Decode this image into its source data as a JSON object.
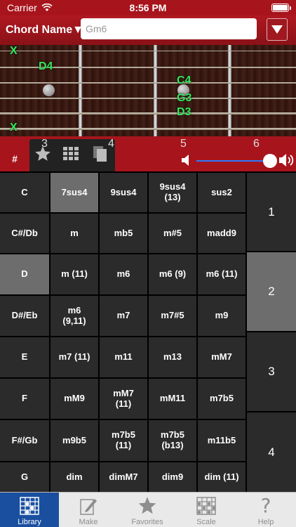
{
  "status": {
    "carrier": "Carrier",
    "time": "8:56 PM"
  },
  "header": {
    "chord_name_label": "Chord Name▼",
    "chord_input_placeholder": "Gm6"
  },
  "fretboard": {
    "markers": [
      {
        "text": "X"
      },
      {
        "text": "D4"
      },
      {
        "text": "C4"
      },
      {
        "text": "G3"
      },
      {
        "text": "D3"
      },
      {
        "text": "X"
      }
    ],
    "fret_numbers": [
      "3",
      "4",
      "5",
      "6"
    ]
  },
  "toolbar": {
    "sharp_label": "#",
    "icons": [
      "star-icon",
      "grid-icon",
      "copy-icon",
      "speaker-icon",
      "volume-icon"
    ],
    "volume_level": 0.95,
    "accent": "#2d7bff"
  },
  "roots": [
    "C",
    "C#/Db",
    "D",
    "D#/Eb",
    "E",
    "F",
    "F#/Gb",
    "G"
  ],
  "selected_root": "D",
  "chord_types": [
    [
      "7sus4",
      "9sus4",
      "9sus4\n(13)",
      "sus2"
    ],
    [
      "m",
      "mb5",
      "m#5",
      "madd9"
    ],
    [
      "m (11)",
      "m6",
      "m6 (9)",
      "m6 (11)"
    ],
    [
      "m6\n(9,11)",
      "m7",
      "m7#5",
      "m9"
    ],
    [
      "m7 (11)",
      "m11",
      "m13",
      "mM7"
    ],
    [
      "mM9",
      "mM7\n(11)",
      "mM11",
      "m7b5"
    ],
    [
      "m9b5",
      "m7b5\n(11)",
      "m7b5\n(b13)",
      "m11b5"
    ],
    [
      "dim",
      "dimM7",
      "dim9",
      "dim (11)"
    ]
  ],
  "selected_chord_type": "7sus4",
  "fingerings": [
    "1",
    "2",
    "3",
    "4"
  ],
  "selected_fingering": "2",
  "tabs": [
    {
      "label": "Library",
      "icon": "library-icon",
      "active": true
    },
    {
      "label": "Make",
      "icon": "pencil-icon"
    },
    {
      "label": "Favorites",
      "icon": "star-icon"
    },
    {
      "label": "Scale",
      "icon": "scale-icon"
    },
    {
      "label": "Help",
      "icon": "help-icon"
    }
  ],
  "colors": {
    "brand_red": "#a8141c",
    "note_green": "#33e85a",
    "selected_cell": "#6d6d6d",
    "tab_active": "#1a4fa0"
  }
}
